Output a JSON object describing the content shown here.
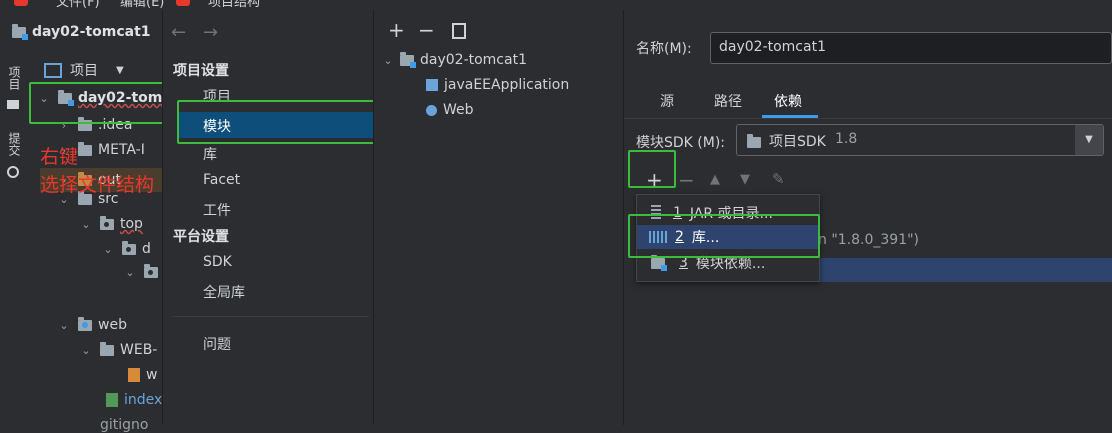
{
  "menubar": {
    "items": [
      "文件(F)",
      "编辑(E)"
    ],
    "dialog_title": "项目结构"
  },
  "project_panel": {
    "title": "day02-tomcat1",
    "view_selector": "项目",
    "side_tabs": [
      "项目",
      "提交"
    ],
    "tree": [
      {
        "label": "day02-tom",
        "icon": "module-folder-icon",
        "expanded": true
      },
      {
        "label": ".idea",
        "icon": "folder-icon"
      },
      {
        "label": "META-I",
        "icon": "folder-icon"
      },
      {
        "label": "out",
        "icon": "orange-folder-icon"
      },
      {
        "label": "src",
        "icon": "folder-icon",
        "expanded": true
      },
      {
        "label": "top",
        "icon": "package-icon",
        "expanded": true
      },
      {
        "label": "d",
        "icon": "package-icon"
      },
      {
        "label": "",
        "icon": "package-icon"
      },
      {
        "label": "web",
        "icon": "web-folder-icon",
        "expanded": true
      },
      {
        "label": "WEB-",
        "icon": "folder-icon"
      },
      {
        "label": "w",
        "icon": "xml-file-icon"
      },
      {
        "label": "index",
        "icon": "html-file-icon"
      },
      {
        "label": "gitigno",
        "icon": "file-icon"
      }
    ]
  },
  "annotation": {
    "line1": "右键",
    "line2": "选择文件结构"
  },
  "settings_nav": {
    "project_settings_header": "项目设置",
    "project_items": [
      "项目",
      "模块",
      "库",
      "Facet",
      "工件"
    ],
    "platform_settings_header": "平台设置",
    "platform_items": [
      "SDK",
      "全局库"
    ],
    "problems": "问题",
    "selected": "模块"
  },
  "module_tree": {
    "root": "day02-tomcat1",
    "children": [
      "javaEEApplication",
      "Web"
    ]
  },
  "module_detail": {
    "name_label": "名称(M):",
    "name_value": "day02-tomcat1",
    "tabs": [
      "源",
      "路径",
      "依赖"
    ],
    "active_tab": "依赖",
    "sdk_label": "模块SDK (M):",
    "sdk_value": "项目SDK",
    "sdk_version": "1.8",
    "behind_text": "n \"1.8.0_391\")"
  },
  "popup_menu": {
    "items": [
      {
        "num": "1",
        "label": "JAR 或目录..."
      },
      {
        "num": "2",
        "label": "库..."
      },
      {
        "num": "3",
        "label": "模块依赖..."
      }
    ],
    "selected_index": 1
  },
  "colors": {
    "selection": "#2e436e",
    "annotation_red": "#e8372b",
    "highlight_box": "#3dbb3d",
    "nav_selected": "#0d4f7a"
  }
}
